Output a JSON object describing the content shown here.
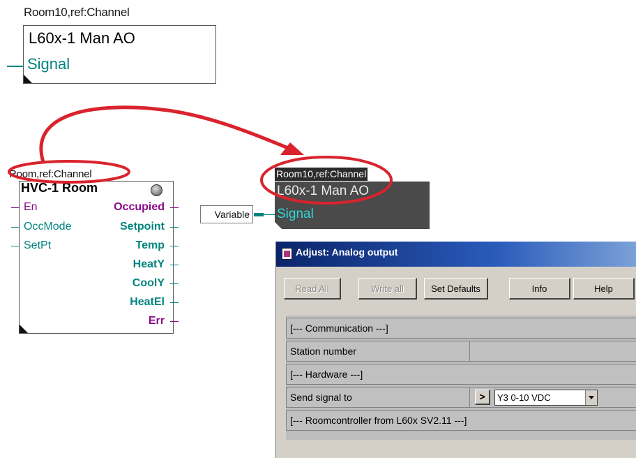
{
  "block_top": {
    "ref": "Room10,ref:Channel",
    "title": "L60x-1 Man AO",
    "signal": "Signal"
  },
  "hvc_block": {
    "ref": "Room,ref:Channel",
    "title": "HVC-1 Room",
    "inputs": [
      "En",
      "OccMode",
      "SetPt"
    ],
    "outputs": [
      "Occupied",
      "Setpoint",
      "Temp",
      "HeatY",
      "CoolY",
      "HeatEl",
      "Err"
    ]
  },
  "variable_label": "Variable",
  "block_dark": {
    "ref": "Room10,ref:Channel",
    "title": "L60x-1 Man AO",
    "signal": "Signal"
  },
  "dialog": {
    "title": "Adjust: Analog output",
    "buttons": {
      "read_all": "Read All",
      "write_all": "Write all",
      "set_defaults": "Set Defaults",
      "info": "Info",
      "help": "Help"
    },
    "rows": {
      "communication": "[--- Communication ---]",
      "station_number": "Station number",
      "hardware": "[--- Hardware ---]",
      "send_signal_to": "Send signal to",
      "send_signal_arrow": ">",
      "send_signal_value": "Y3 0-10 VDC",
      "roomcontroller": "[--- Roomcontroller from L60x SV2.11 ---]"
    }
  },
  "colors": {
    "annotation_red": "#d9232d",
    "pin_teal": "#00847f",
    "pin_purple": "#8a0a8a",
    "dialog_title_blue": "#0a246a"
  }
}
